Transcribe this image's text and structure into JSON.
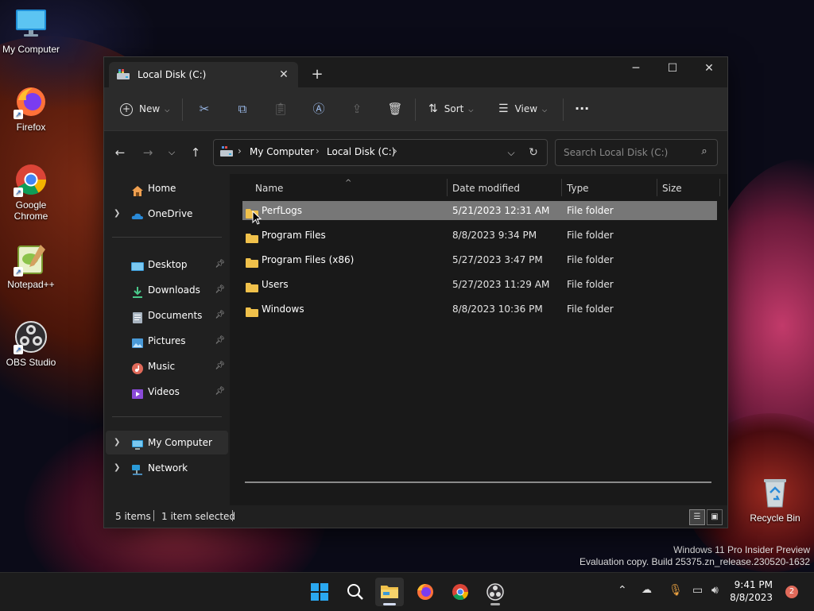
{
  "desktop": {
    "icons": [
      {
        "label": "My Computer"
      },
      {
        "label": "Firefox"
      },
      {
        "label": "Google Chrome"
      },
      {
        "label": "Notepad++"
      },
      {
        "label": "OBS Studio"
      },
      {
        "label": "Recycle Bin"
      }
    ],
    "watermark": {
      "line1": "Windows 11 Pro Insider Preview",
      "line2": "Evaluation copy. Build 25375.zn_release.230520-1632"
    }
  },
  "window": {
    "tab_title": "Local Disk (C:)",
    "toolbar": {
      "new_label": "New",
      "sort_label": "Sort",
      "view_label": "View",
      "more_label": "···"
    },
    "address": {
      "crumbs": [
        "My Computer",
        "Local Disk (C:)"
      ],
      "search_placeholder": "Search Local Disk (C:)"
    },
    "nav": {
      "home": "Home",
      "onedrive": "OneDrive",
      "desktop": "Desktop",
      "downloads": "Downloads",
      "documents": "Documents",
      "pictures": "Pictures",
      "music": "Music",
      "videos": "Videos",
      "my_computer": "My Computer",
      "network": "Network"
    },
    "columns": {
      "name": "Name",
      "date": "Date modified",
      "type": "Type",
      "size": "Size"
    },
    "files": [
      {
        "name": "PerfLogs",
        "date": "5/21/2023 12:31 AM",
        "type": "File folder"
      },
      {
        "name": "Program Files",
        "date": "8/8/2023 9:34 PM",
        "type": "File folder"
      },
      {
        "name": "Program Files (x86)",
        "date": "5/27/2023 3:47 PM",
        "type": "File folder"
      },
      {
        "name": "Users",
        "date": "5/27/2023 11:29 AM",
        "type": "File folder"
      },
      {
        "name": "Windows",
        "date": "8/8/2023 10:36 PM",
        "type": "File folder"
      }
    ],
    "status": {
      "items": "5 items",
      "selected": "1 item selected"
    }
  },
  "taskbar": {
    "time": "9:41 PM",
    "date": "8/8/2023",
    "notification_count": "2"
  },
  "colors": {
    "folder": "#f0c14b",
    "accent": "#4cc2ff",
    "selection": "#777777"
  }
}
